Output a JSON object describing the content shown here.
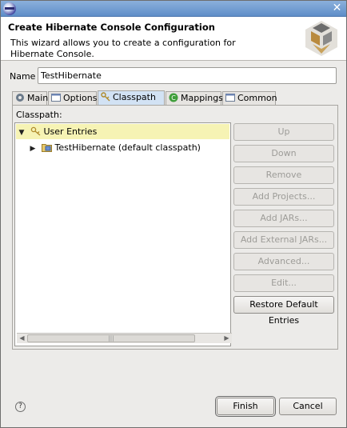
{
  "window": {
    "title": ""
  },
  "banner": {
    "title": "Create Hibernate Console Configuration",
    "description": "This wizard allows you to create a configuration for Hibernate Console."
  },
  "name_field": {
    "label": "Name",
    "value": "TestHibernate"
  },
  "tabs": [
    {
      "label": "Main",
      "icon": "main-config-icon",
      "active": false
    },
    {
      "label": "Options",
      "icon": "options-icon",
      "active": false
    },
    {
      "label": "Classpath",
      "icon": "classpath-icon",
      "active": true
    },
    {
      "label": "Mappings",
      "icon": "mappings-icon",
      "active": false
    },
    {
      "label": "Common",
      "icon": "common-icon",
      "active": false
    }
  ],
  "classpath": {
    "label": "Classpath:",
    "tree": [
      {
        "label": "User Entries",
        "expanded": true,
        "selected": true,
        "icon": "user-entries-icon"
      },
      {
        "label": "TestHibernate (default classpath)",
        "expanded": false,
        "selected": false,
        "icon": "project-icon"
      }
    ],
    "buttons": [
      {
        "label": "Up",
        "enabled": false
      },
      {
        "label": "Down",
        "enabled": false
      },
      {
        "label": "Remove",
        "enabled": false
      },
      {
        "label": "Add Projects...",
        "enabled": false
      },
      {
        "label": "Add JARs...",
        "enabled": false
      },
      {
        "label": "Add External JARs...",
        "enabled": false
      },
      {
        "label": "Advanced...",
        "enabled": false
      },
      {
        "label": "Edit...",
        "enabled": false
      },
      {
        "label": "Restore Default Entries",
        "enabled": true
      }
    ]
  },
  "footer": {
    "help_icon": "help-icon",
    "finish_label": "Finish",
    "cancel_label": "Cancel"
  },
  "colors": {
    "selection_bg": "#f6f3b4",
    "active_tab_bg": "#d2e2f4",
    "titlebar": "#6f9bd0"
  }
}
